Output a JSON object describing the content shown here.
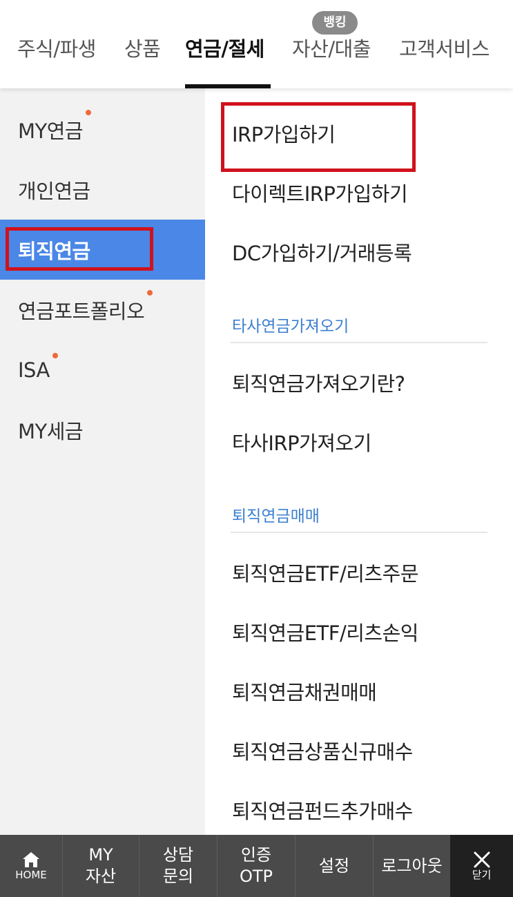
{
  "top_tabs": [
    {
      "label": "주식/파생"
    },
    {
      "label": "상품"
    },
    {
      "label": "연금/절세",
      "active": true
    },
    {
      "label": "자산/대출"
    },
    {
      "label": "고객서비스"
    }
  ],
  "top_badge": "뱅킹",
  "left_menu": [
    {
      "label": "MY연금",
      "dot": true
    },
    {
      "label": "개인연금"
    },
    {
      "label": "퇴직연금",
      "active": true
    },
    {
      "label": "연금포트폴리오",
      "dot": true
    },
    {
      "label": "ISA",
      "dot": true
    },
    {
      "label": "MY세금"
    }
  ],
  "right_menu": {
    "items_group1": [
      "IRP가입하기",
      "다이렉트IRP가입하기",
      "DC가입하기/거래등록"
    ],
    "section1_title": "타사연금가져오기",
    "items_group2": [
      "퇴직연금가져오기란?",
      "타사IRP가져오기"
    ],
    "section2_title": "퇴직연금매매",
    "items_group3": [
      "퇴직연금ETF/리츠주문",
      "퇴직연금ETF/리츠손익",
      "퇴직연금채권매매",
      "퇴직연금상품신규매수",
      "퇴직연금펀드추가매수"
    ]
  },
  "bottom_bar": {
    "home": "HOME",
    "my_assets_line1": "MY",
    "my_assets_line2": "자산",
    "consult_line1": "상담",
    "consult_line2": "문의",
    "otp_line1": "인증",
    "otp_line2": "OTP",
    "settings": "설정",
    "logout": "로그아웃",
    "close": "닫기"
  },
  "colors": {
    "active_left_bg": "#4a87e6",
    "section_title": "#3b7fd0",
    "highlight_border": "#d0121c",
    "notification_dot": "#ee6a3a",
    "bottom_bar_bg": "#4a4a4a"
  }
}
